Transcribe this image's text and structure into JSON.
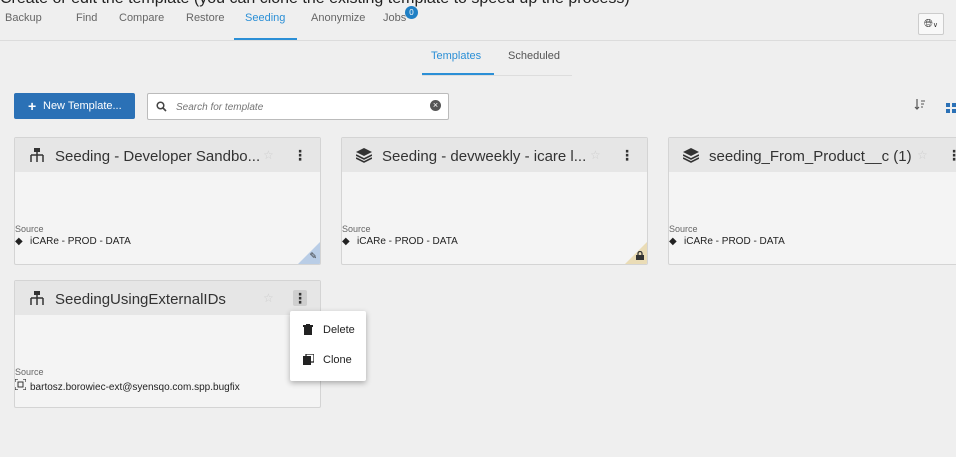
{
  "caption": "Create or edit the template (you can clone the existing template to speed up the process)",
  "nav": {
    "items": [
      "Backup",
      "Find",
      "Compare",
      "Restore",
      "Seeding",
      "Anonymize",
      "Jobs"
    ],
    "active": "Seeding",
    "jobs_badge": "0"
  },
  "subtabs": {
    "items": [
      "Templates",
      "Scheduled"
    ],
    "active": "Templates"
  },
  "toolbar": {
    "new_template_label": "New Template...",
    "search_placeholder": "Search for template"
  },
  "cards": [
    {
      "title": "Seeding - Developer Sandbo...",
      "type_icon": "hierarchy-icon",
      "source_label": "Source",
      "source_value": "iCARe - PROD - DATA",
      "source_icon": "diamond-icon",
      "corner": "edit"
    },
    {
      "title": "Seeding - devweekly - icare l...",
      "type_icon": "layers-icon",
      "source_label": "Source",
      "source_value": "iCARe - PROD - DATA",
      "source_icon": "diamond-icon",
      "corner": "lock"
    },
    {
      "title": "seeding_From_Product__c (1)",
      "type_icon": "layers-icon",
      "source_label": "Source",
      "source_value": "iCARe - PROD - DATA",
      "source_icon": "diamond-icon",
      "corner": "none"
    },
    {
      "title": "SeedingUsingExternalIDs",
      "type_icon": "hierarchy-icon",
      "source_label": "Source",
      "source_value": "bartosz.borowiec-ext@syensqo.com.spp.bugfix",
      "source_icon": "sandbox-icon",
      "corner": "none"
    }
  ],
  "context_menu": {
    "items": [
      "Delete",
      "Clone"
    ]
  },
  "colors": {
    "accent": "#2b8fd6",
    "primary_button": "#2b71b6",
    "edit_corner": "#b9cde6",
    "lock_corner": "#eadcb6"
  }
}
